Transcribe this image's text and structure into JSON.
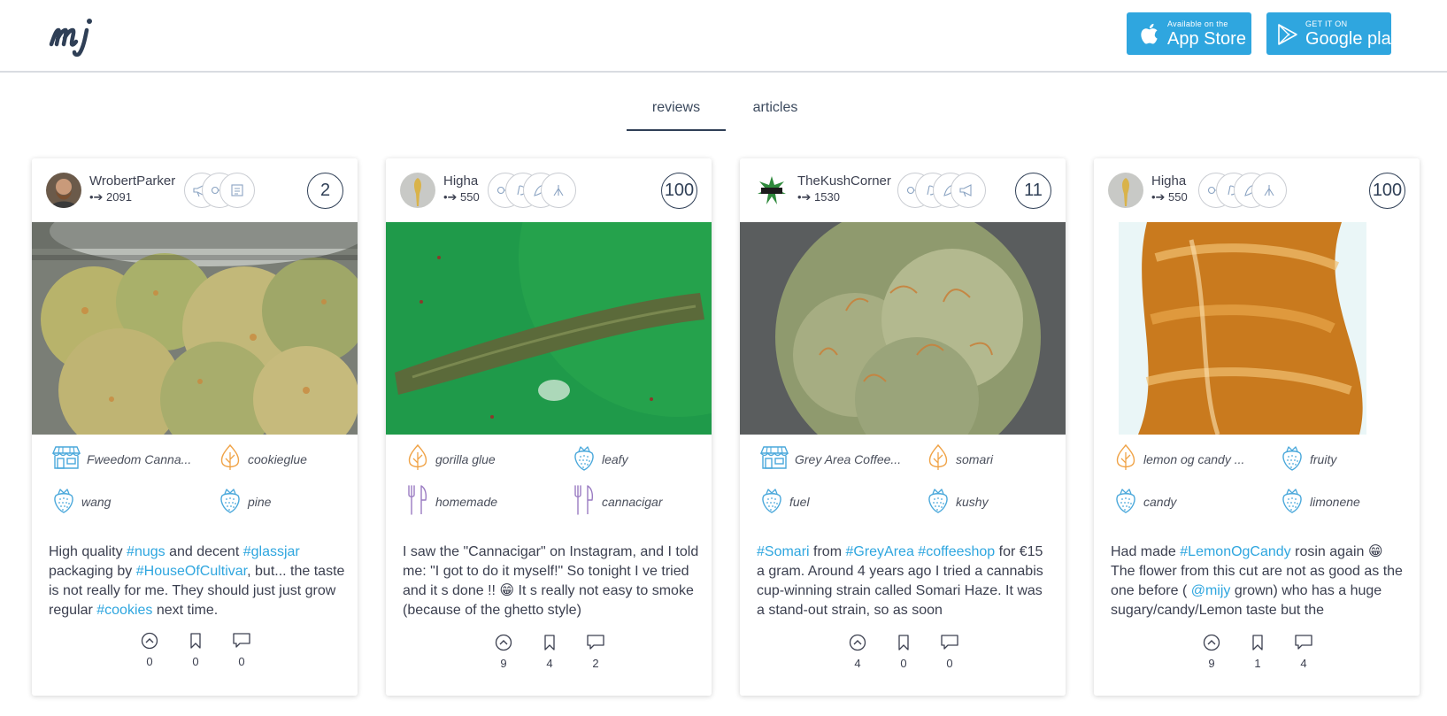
{
  "header": {
    "logo_text": "mj",
    "app_store": {
      "small": "Available on the",
      "big": "App Store"
    },
    "google_play": {
      "small": "GET IT ON",
      "big": "Google play"
    }
  },
  "tabs": [
    {
      "label": "reviews",
      "active": true
    },
    {
      "label": "articles",
      "active": false
    }
  ],
  "colors": {
    "accent": "#2fa6df",
    "navy": "#2f3f56",
    "orange": "#f0a347",
    "blue_icon": "#4aa8db",
    "purple": "#9a7bc2"
  },
  "cards": [
    {
      "user": "WrobertParker",
      "points": "•➔ 2091",
      "score": "2",
      "tags": [
        {
          "icon": "shop-icon",
          "label": "Fweedom Canna..."
        },
        {
          "icon": "leaf-icon",
          "label": "cookieglue"
        },
        {
          "icon": "strawberry-icon",
          "label": "wang"
        },
        {
          "icon": "strawberry-icon",
          "label": "pine"
        }
      ],
      "text_parts": [
        "High quality ",
        "#nugs",
        " and decent ",
        "#glassjar",
        " packaging by ",
        "#HouseOfCultivar",
        ", but... the taste is not really for me. They should just just grow regular ",
        "#cookies",
        " next time."
      ],
      "votes": "0",
      "saves": "0",
      "comments": "0"
    },
    {
      "user": "Higha",
      "points": "•➔ 550",
      "score": "100",
      "tags": [
        {
          "icon": "leaf-icon",
          "label": "gorilla glue"
        },
        {
          "icon": "strawberry-icon",
          "label": "leafy"
        },
        {
          "icon": "fork-knife-icon",
          "label": "homemade"
        },
        {
          "icon": "fork-knife-icon",
          "label": "cannacigar"
        }
      ],
      "text_parts": [
        "I saw the \"Cannacigar\" on Instagram, and I told me: \"I got to do it myself!\" So tonight I ve tried and it s done !! 😁 It s really not easy to smoke (because of the ghetto style)"
      ],
      "votes": "9",
      "saves": "4",
      "comments": "2"
    },
    {
      "user": "TheKushCorner",
      "points": "•➔ 1530",
      "score": "11",
      "tags": [
        {
          "icon": "shop-icon",
          "label": "Grey Area Coffee..."
        },
        {
          "icon": "leaf-icon",
          "label": "somari"
        },
        {
          "icon": "strawberry-icon",
          "label": "fuel"
        },
        {
          "icon": "strawberry-icon",
          "label": "kushy"
        }
      ],
      "text_parts": [
        "#Somari",
        " from ",
        "#GreyArea",
        " ",
        "#coffeeshop",
        " for €15 a gram. Around 4 years ago I tried a cannabis cup-winning strain called Somari Haze. It was a stand-out strain, so as soon"
      ],
      "votes": "4",
      "saves": "0",
      "comments": "0"
    },
    {
      "user": "Higha",
      "points": "•➔ 550",
      "score": "100",
      "tags": [
        {
          "icon": "leaf-icon",
          "label": "lemon og candy ..."
        },
        {
          "icon": "strawberry-icon",
          "label": "fruity"
        },
        {
          "icon": "strawberry-icon",
          "label": "candy"
        },
        {
          "icon": "strawberry-icon",
          "label": "limonene"
        }
      ],
      "text_parts": [
        "Had made ",
        "#LemonOgCandy",
        " rosin again 😁 The flower from this cut are not as good as the one before ( ",
        "@mijy",
        " grown) who has a huge sugary/candy/Lemon taste but the"
      ],
      "votes": "9",
      "saves": "1",
      "comments": "4"
    }
  ]
}
